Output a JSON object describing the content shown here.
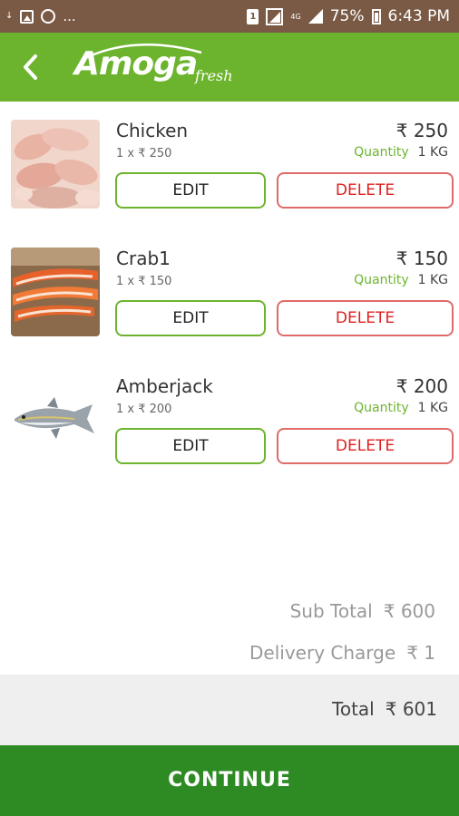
{
  "status_bar": {
    "lte_label": "4G",
    "battery_text": "75%",
    "time": "6:43 PM",
    "sim_label": "1",
    "overflow": "..."
  },
  "app_bar": {
    "logo_main": "Amoga",
    "logo_sub": "fresh",
    "brand_color": "#6db42e"
  },
  "items": [
    {
      "name": "Chicken",
      "unit_line": "1 x ₹ 250",
      "price": "₹ 250",
      "quantity_label": "Quantity",
      "quantity_value": "1 KG",
      "edit_label": "EDIT",
      "delete_label": "DELETE"
    },
    {
      "name": "Crab1",
      "unit_line": "1 x ₹ 150",
      "price": "₹ 150",
      "quantity_label": "Quantity",
      "quantity_value": "1 KG",
      "edit_label": "EDIT",
      "delete_label": "DELETE"
    },
    {
      "name": "Amberjack",
      "unit_line": "1 x ₹ 200",
      "price": "₹ 200",
      "quantity_label": "Quantity",
      "quantity_value": "1 KG",
      "edit_label": "EDIT",
      "delete_label": "DELETE"
    }
  ],
  "summary": {
    "subtotal_label": "Sub Total",
    "subtotal_value": "₹ 600",
    "delivery_label": "Delivery Charge",
    "delivery_value": "₹ 1",
    "total_label": "Total",
    "total_value": "₹ 601"
  },
  "continue_label": "CONTINUE",
  "colors": {
    "status_bar": "#7a5a45",
    "accent_green": "#6db42e",
    "continue_green": "#2e8b24",
    "delete_red": "#e02020"
  }
}
